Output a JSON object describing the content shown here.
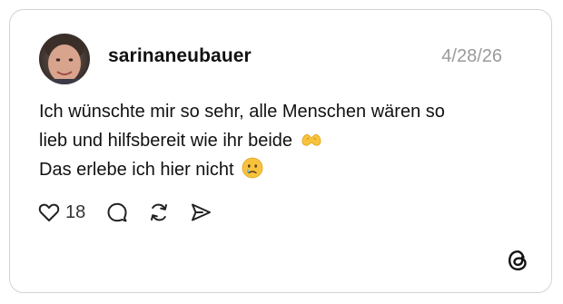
{
  "post": {
    "username": "sarinaneubauer",
    "date": "4/28/26",
    "text_lines": [
      "Ich wünschte mir so sehr, alle Menschen wären so",
      "lieb und hilfsbereit wie ihr beide",
      "Das erlebe ich hier nicht"
    ],
    "emojis": {
      "line2": "heart-hands-emoji",
      "line3": "crying-face-emoji"
    },
    "like_count": "18"
  },
  "icons": {
    "like": "heart-icon",
    "reply": "comment-icon",
    "repost": "repost-icon",
    "share": "share-icon",
    "brand": "threads-logo"
  },
  "colors": {
    "border": "#d3d3d3",
    "text": "#111111",
    "muted": "#9a9a9a",
    "emoji_yellow": "#f7c33c"
  }
}
